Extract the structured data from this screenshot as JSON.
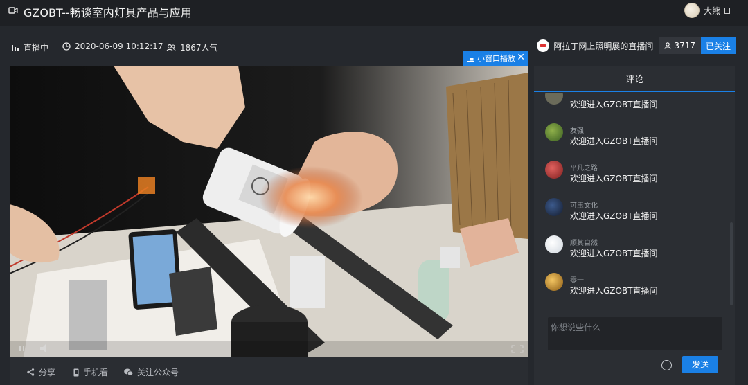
{
  "header": {
    "title": "GZOBT--畅谈室内灯具产品与应用",
    "user_name": "大熊"
  },
  "info": {
    "status": "直播中",
    "datetime": "2020-06-09 10:12:17",
    "popularity": "1867人气",
    "anchor_name": "阿拉丁网上照明展的直播间",
    "fans": "3717",
    "follow_label": "已关注"
  },
  "video": {
    "pip_label": "小窗口播放"
  },
  "bottom": {
    "share": "分享",
    "mobile": "手机看",
    "follow_wechat": "关注公众号"
  },
  "comments_panel": {
    "title": "评论",
    "items": [
      {
        "name": "…",
        "text": "欢迎进入GZOBT直播间",
        "avatar_color": "#6b6b5a"
      },
      {
        "name": "友强",
        "text": "欢迎进入GZOBT直播间",
        "avatar_color": "#4c7a2f"
      },
      {
        "name": "平凡之路",
        "text": "欢迎进入GZOBT直播间",
        "avatar_color": "#b23b3b"
      },
      {
        "name": "可玉文化",
        "text": "欢迎进入GZOBT直播间",
        "avatar_color": "#22324f"
      },
      {
        "name": "顺其自然",
        "text": "欢迎进入GZOBT直播间",
        "avatar_color": "#e5e9ee"
      },
      {
        "name": "零一",
        "text": "欢迎进入GZOBT直播间",
        "avatar_color": "#d9a23a"
      }
    ],
    "input_placeholder": "你想说些什么",
    "send_label": "发送"
  },
  "colors": {
    "accent": "#1a80e6",
    "background": "#25282d"
  }
}
